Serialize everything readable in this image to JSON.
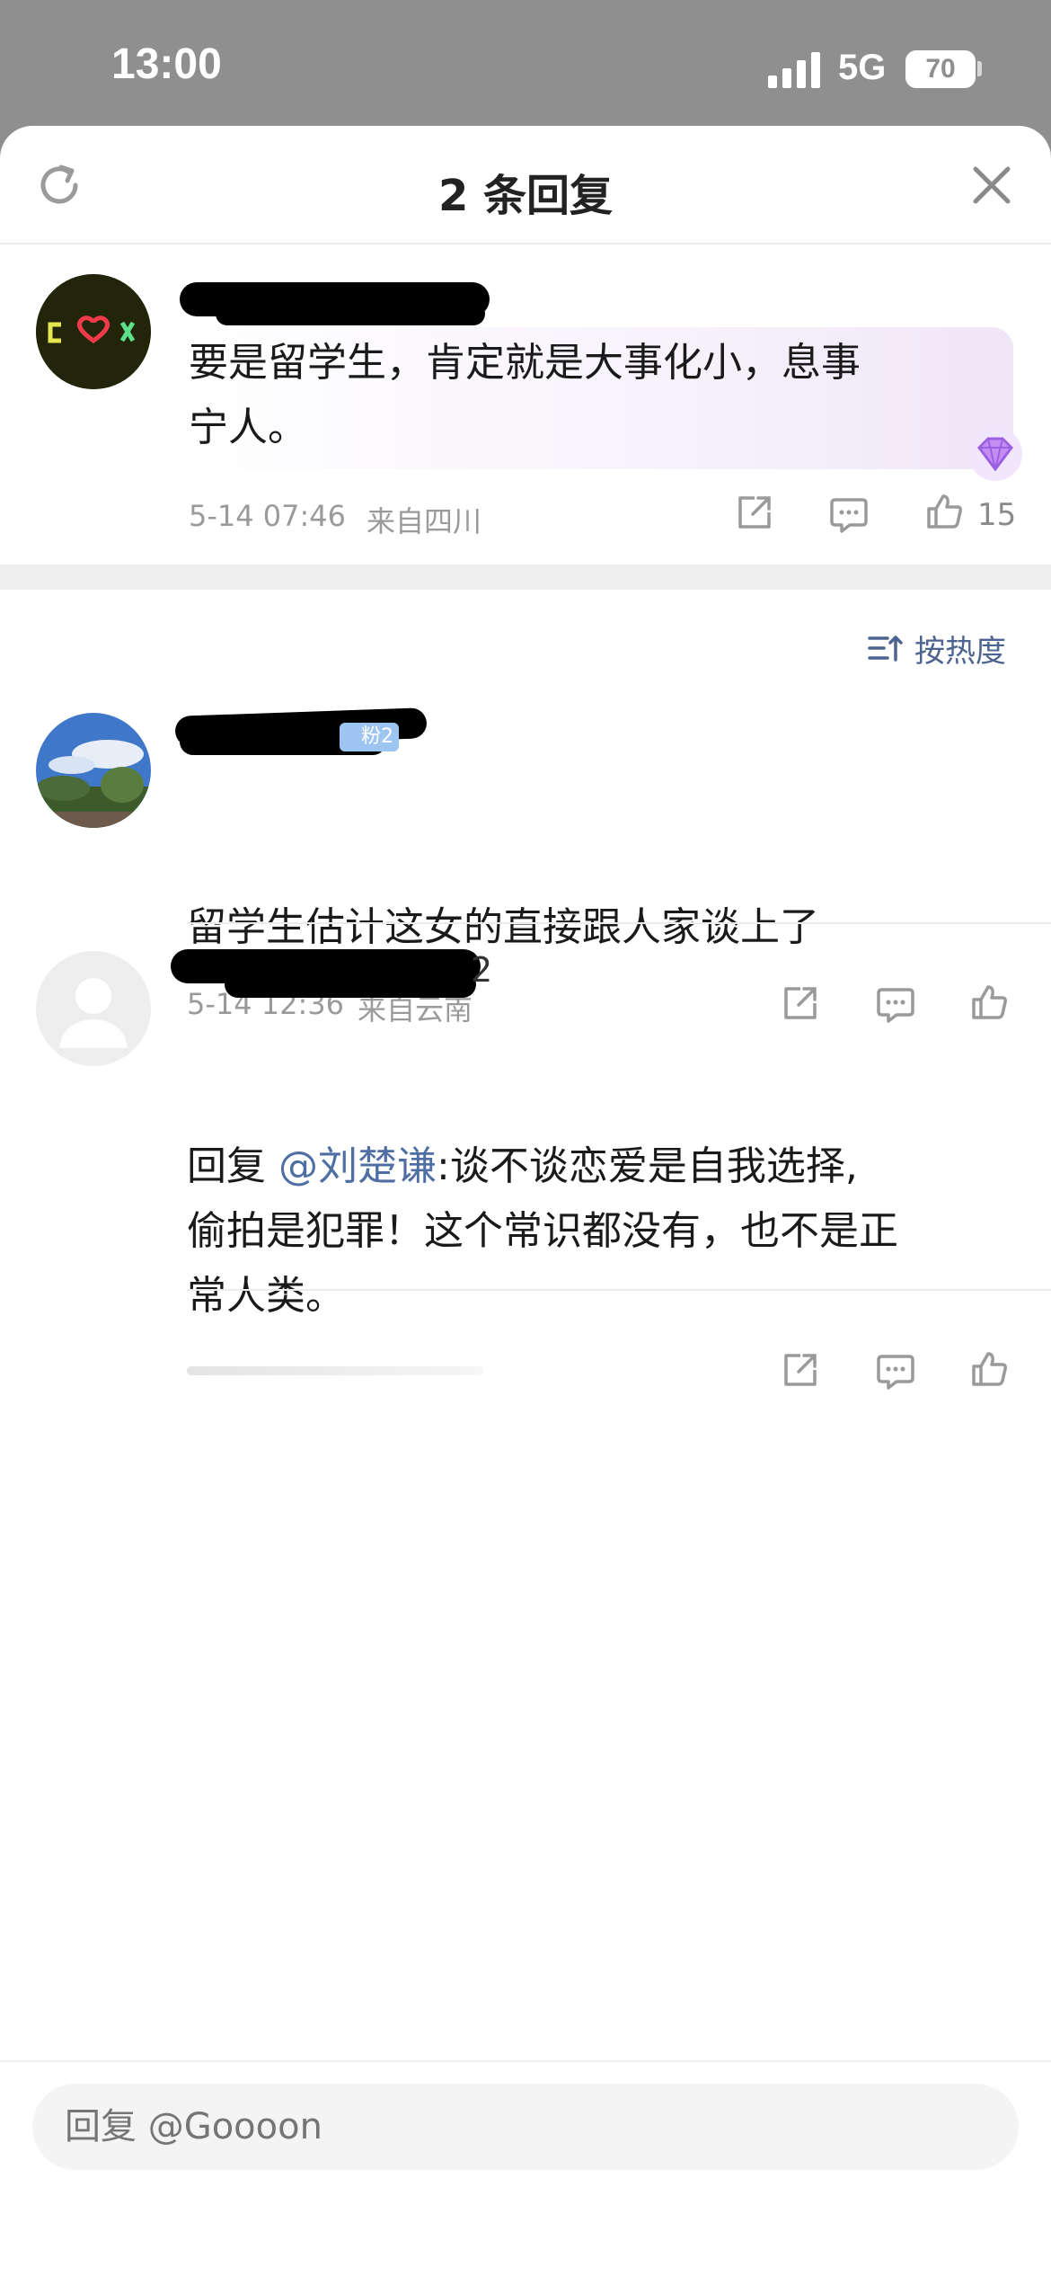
{
  "status_bar": {
    "time": "13:00",
    "network": "5G",
    "battery": "70"
  },
  "header": {
    "title": "2 条回复",
    "refresh_icon": "refresh-icon",
    "close_icon": "close-icon"
  },
  "main_comment": {
    "text_line1": "要是留学生，肯定就是大事化小，息事",
    "text_line2": "宁人。",
    "date": "5-14 07:46",
    "location": "来自四川",
    "like_count": "15",
    "highlight_color": "#f4eefb"
  },
  "sort": {
    "label": "按热度"
  },
  "replies": [
    {
      "text": "留学生估计这女的直接跟人家谈上了",
      "date": "5-14 12:36",
      "location": "来自云南",
      "badge": "粉2"
    },
    {
      "reply_prefix": "回复 ",
      "mention": "@刘楚谦",
      "text_line1": ":谈不谈恋爱是自我选择,",
      "text_line2": "偷拍是犯罪！这个常识都没有，也不是正",
      "text_line3": "常人类。",
      "name_suffix": "2"
    }
  ],
  "footer": {
    "reply_placeholder": "回复 @Goooon"
  },
  "colors": {
    "accent": "#4d6390",
    "background": "#ffffff",
    "status_bar": "#8f8f8f"
  }
}
